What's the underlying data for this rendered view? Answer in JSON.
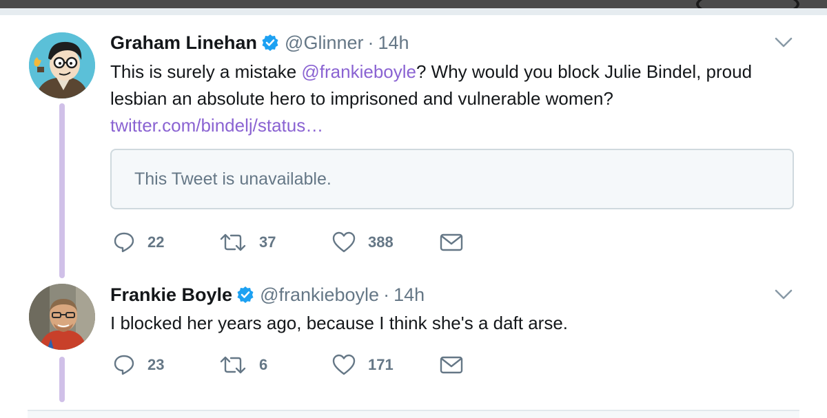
{
  "tweets": [
    {
      "name": "Graham Linehan",
      "handle": "@Glinner",
      "dot": "·",
      "time": "14h",
      "text_before": "This is surely a mistake ",
      "mention": "@frankieboyle",
      "text_after": "? Why would you block Julie Bindel, proud lesbian an absolute hero to imprisoned and vulnerable women?",
      "link": "twitter.com/bindelj/status…",
      "quoted_tweet": "This Tweet is unavailable.",
      "replies": "22",
      "retweets": "37",
      "likes": "388"
    },
    {
      "name": "Frankie Boyle",
      "handle": "@frankieboyle",
      "dot": "·",
      "time": "14h",
      "text": "I blocked her years ago, because I think she's a daft arse.",
      "replies": "23",
      "retweets": "6",
      "likes": "171"
    }
  ],
  "colors": {
    "link": "#8a63d2",
    "thread_line": "#d0c0e8",
    "verified": "#1da1f2",
    "muted": "#657786"
  },
  "icons": [
    "verified-badge-icon",
    "chevron-down-icon",
    "reply-icon",
    "retweet-icon",
    "like-icon",
    "direct-message-icon"
  ]
}
